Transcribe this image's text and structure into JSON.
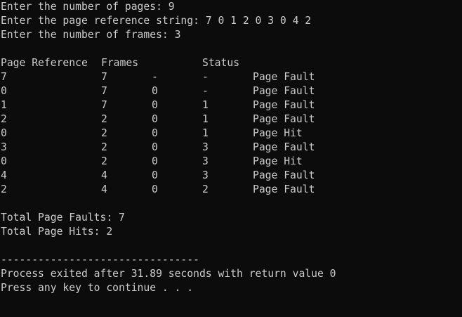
{
  "console": {
    "prompt_pages": "Enter the number of pages: 9",
    "prompt_ref_string": "Enter the page reference string: 7 0 1 2 0 3 0 4 2",
    "prompt_frames": "Enter the number of frames: 3",
    "table": {
      "headers": [
        "Page Reference",
        "Frames",
        "",
        "",
        "Status"
      ],
      "rows": [
        [
          "7",
          "7",
          "-",
          "-",
          "Page Fault"
        ],
        [
          "0",
          "7",
          "0",
          "-",
          "Page Fault"
        ],
        [
          "1",
          "7",
          "0",
          "1",
          "Page Fault"
        ],
        [
          "2",
          "2",
          "0",
          "1",
          "Page Fault"
        ],
        [
          "0",
          "2",
          "0",
          "1",
          "Page Hit"
        ],
        [
          "3",
          "2",
          "0",
          "3",
          "Page Fault"
        ],
        [
          "0",
          "2",
          "0",
          "3",
          "Page Hit"
        ],
        [
          "4",
          "4",
          "0",
          "3",
          "Page Fault"
        ],
        [
          "2",
          "4",
          "0",
          "2",
          "Page Fault"
        ]
      ]
    },
    "total_faults": "Total Page Faults: 7",
    "total_hits": "Total Page Hits: 2",
    "separator": "--------------------------------",
    "process_exit": "Process exited after 31.89 seconds with return value 0",
    "press_key": "Press any key to continue . . ."
  },
  "colors": {
    "background": "#0c0c0c",
    "text": "#cccccc"
  }
}
